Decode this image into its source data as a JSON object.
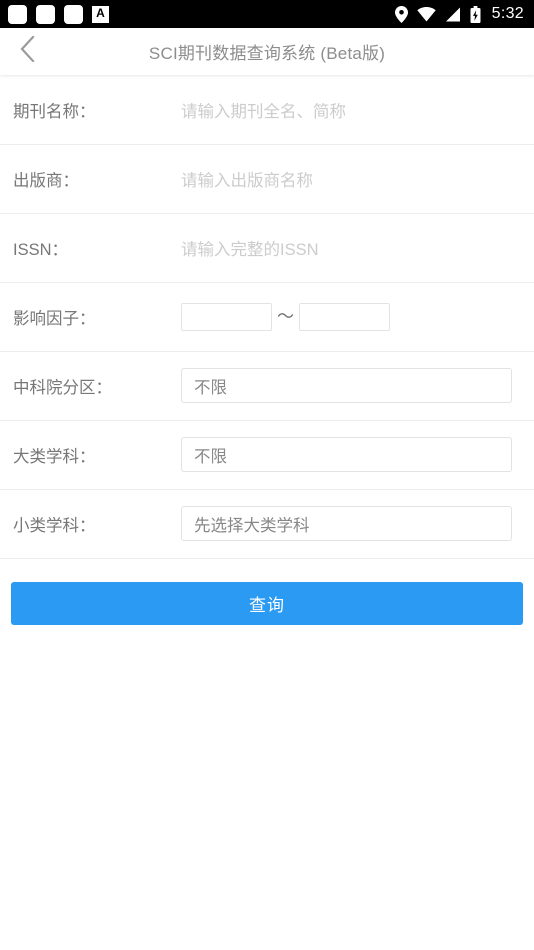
{
  "status_bar": {
    "notification_icons": [
      "notification-square-icon",
      "notification-square-icon",
      "notification-square-icon",
      "letter-a-badge-icon"
    ],
    "letter_badge": "A",
    "system_icons": [
      "location-pin-icon",
      "wifi-icon",
      "cellular-signal-icon",
      "battery-charging-icon"
    ],
    "clock": "5:32",
    "background": "#000000"
  },
  "header": {
    "back_icon": "chevron-left-icon",
    "title": "SCI期刊数据查询系统 (Beta版)",
    "title_color": "#8d8d8d"
  },
  "form": {
    "rows": [
      {
        "label": "期刊名称：",
        "type": "text",
        "value": "",
        "placeholder": "请输入期刊全名、简称",
        "name": "journal-name"
      },
      {
        "label": "出版商：",
        "type": "text",
        "value": "",
        "placeholder": "请输入出版商名称",
        "name": "publisher"
      },
      {
        "label": "ISSN：",
        "type": "text",
        "value": "",
        "placeholder": "请输入完整的ISSN",
        "name": "issn"
      },
      {
        "label": "影响因子：",
        "type": "range",
        "min_value": "",
        "max_value": "",
        "separator": "～",
        "name": "impact-factor"
      },
      {
        "label": "中科院分区：",
        "type": "select",
        "value": "不限",
        "name": "cas-division"
      },
      {
        "label": "大类学科：",
        "type": "select",
        "value": "不限",
        "name": "major-subject"
      },
      {
        "label": "小类学科：",
        "type": "select",
        "value": "先选择大类学科",
        "name": "minor-subject"
      }
    ]
  },
  "submit": {
    "label": "查询",
    "color": "#2b9af3"
  }
}
